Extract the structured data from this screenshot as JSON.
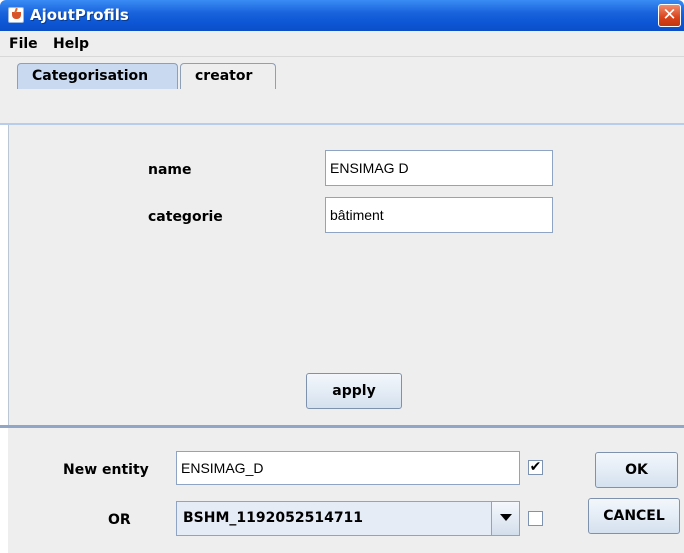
{
  "window": {
    "title": "AjoutProfils",
    "close_glyph": "✕"
  },
  "menu": [
    "File",
    "Help"
  ],
  "tabs": [
    {
      "label": "Categorisation",
      "active": true
    },
    {
      "label": "creator",
      "active": false
    }
  ],
  "form": {
    "name_label": "name",
    "name_value": "ENSIMAG D",
    "categorie_label": "categorie",
    "categorie_value": "bâtiment",
    "apply_label": "apply"
  },
  "bottom": {
    "new_entity_label": "New entity",
    "new_entity_value": "ENSIMAG_D",
    "new_entity_checked": true,
    "check_glyph": "✔",
    "or_label": "OR",
    "combo_value": "BSHM_1192052514711",
    "or_checked": false,
    "ok_label": "OK",
    "cancel_label": "CANCEL"
  }
}
